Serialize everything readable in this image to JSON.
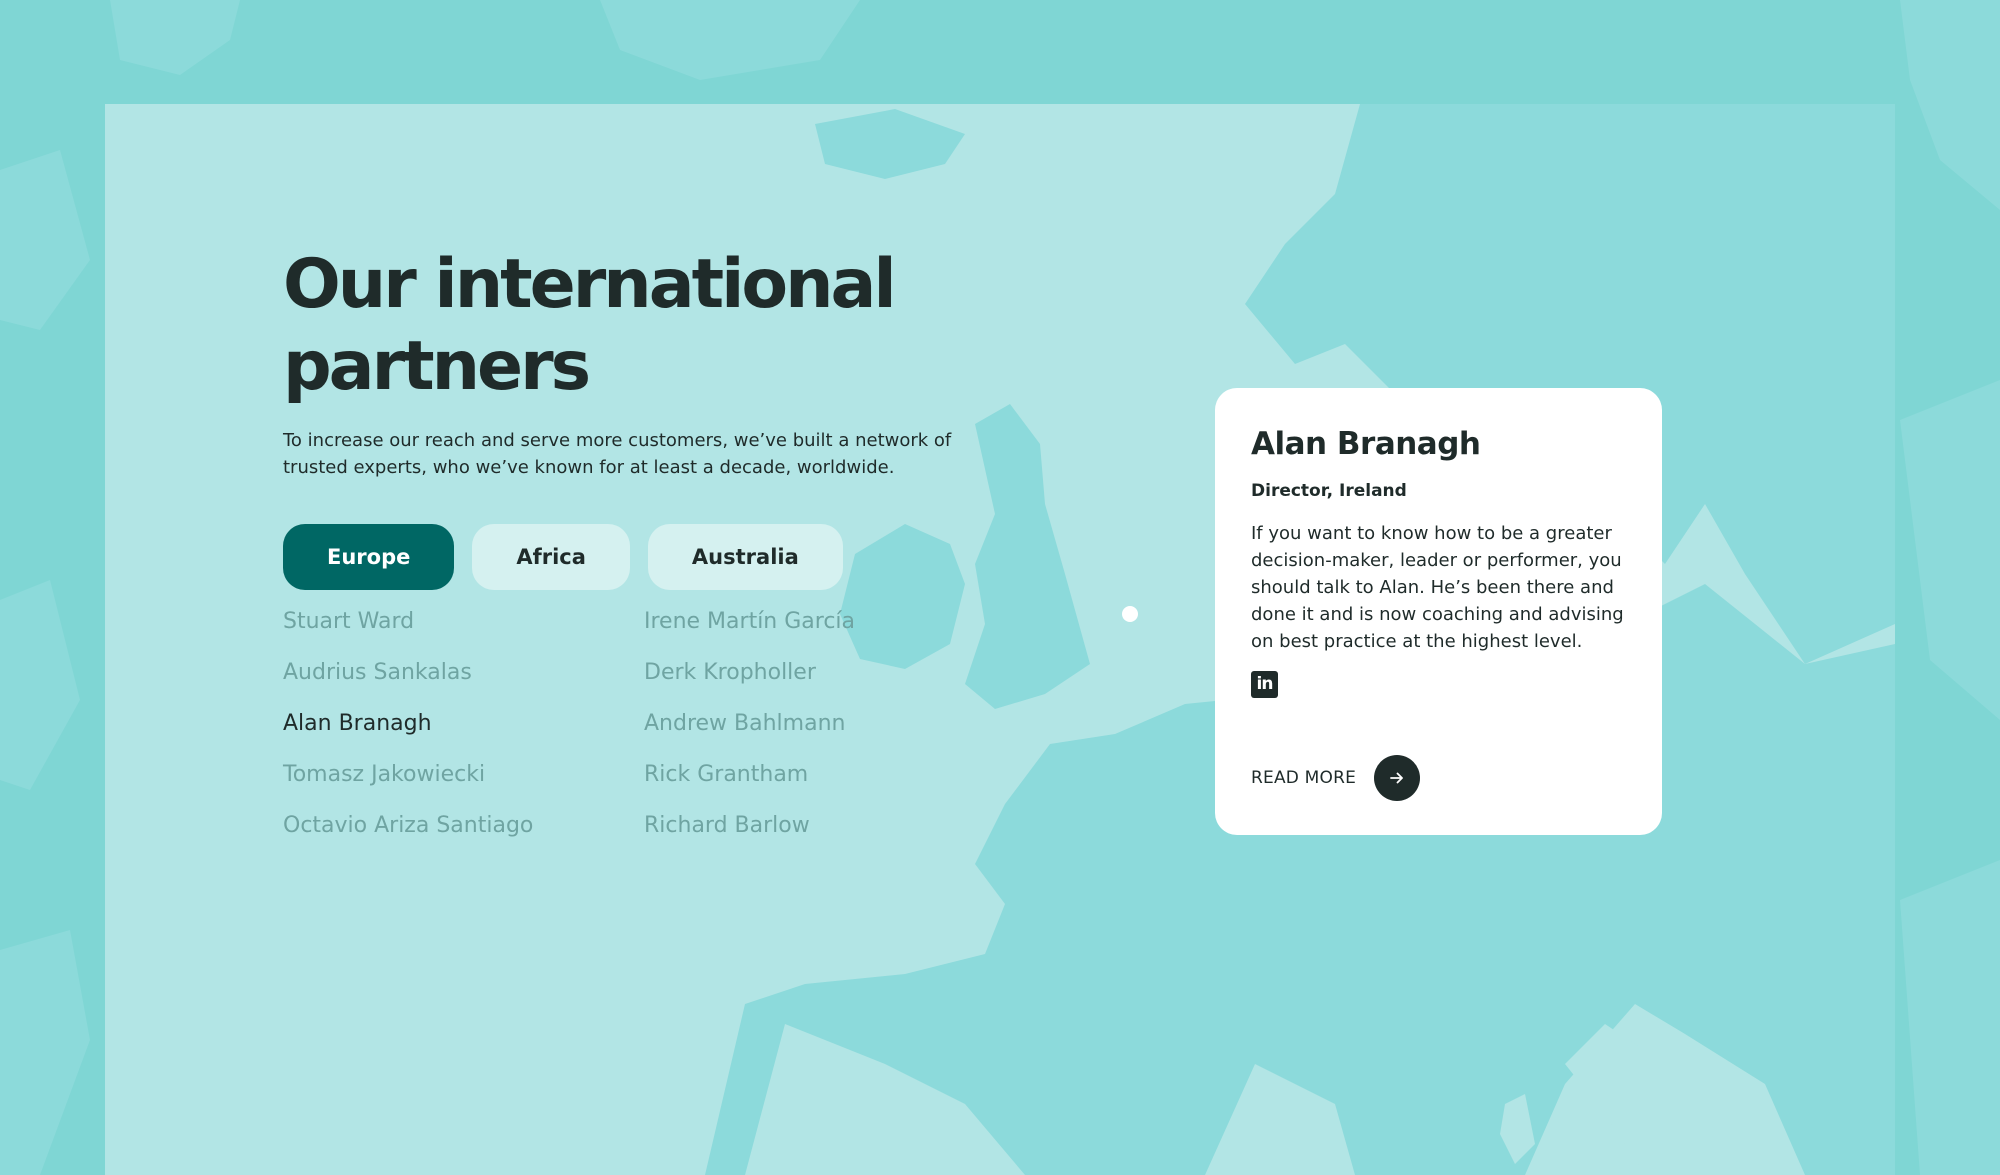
{
  "section": {
    "title": "Our international partners",
    "subtitle": "To increase our reach and serve more customers, we’ve built a network of trusted experts, who we’ve known for at least a decade, worldwide."
  },
  "tabs": [
    {
      "label": "Europe",
      "active": true
    },
    {
      "label": "Africa",
      "active": false
    },
    {
      "label": "Australia",
      "active": false
    }
  ],
  "partners": {
    "column_1": [
      "Stuart Ward",
      "Audrius Sankalas",
      "Alan Branagh",
      "Tomasz Jakowiecki",
      "Octavio Ariza Santiago"
    ],
    "column_2": [
      "Irene Martín García",
      "Derk Kropholler",
      "Andrew Bahlmann",
      "Rick Grantham",
      "Richard Barlow"
    ],
    "selected": "Alan Branagh"
  },
  "card": {
    "name": "Alan Branagh",
    "role": "Director, Ireland",
    "bio": "If you want to know how to be a greater decision-maker, leader or performer, you should talk to Alan. He’s been there and done it and is now coaching and advising on best practice at the highest level.",
    "linkedin_icon": "linkedin-icon",
    "linkedin_glyph": "in",
    "read_more": "READ MORE",
    "arrow_icon": "arrow-right-icon"
  },
  "colors": {
    "outer_bg": "#7fd6d4",
    "panel_bg": "#b2e5e5",
    "land": "#8cdadb",
    "accent": "#006764",
    "tab_inactive": "#d5f1f0",
    "text_dark": "#1f2b2a",
    "text_muted": "#6fa4a2"
  }
}
